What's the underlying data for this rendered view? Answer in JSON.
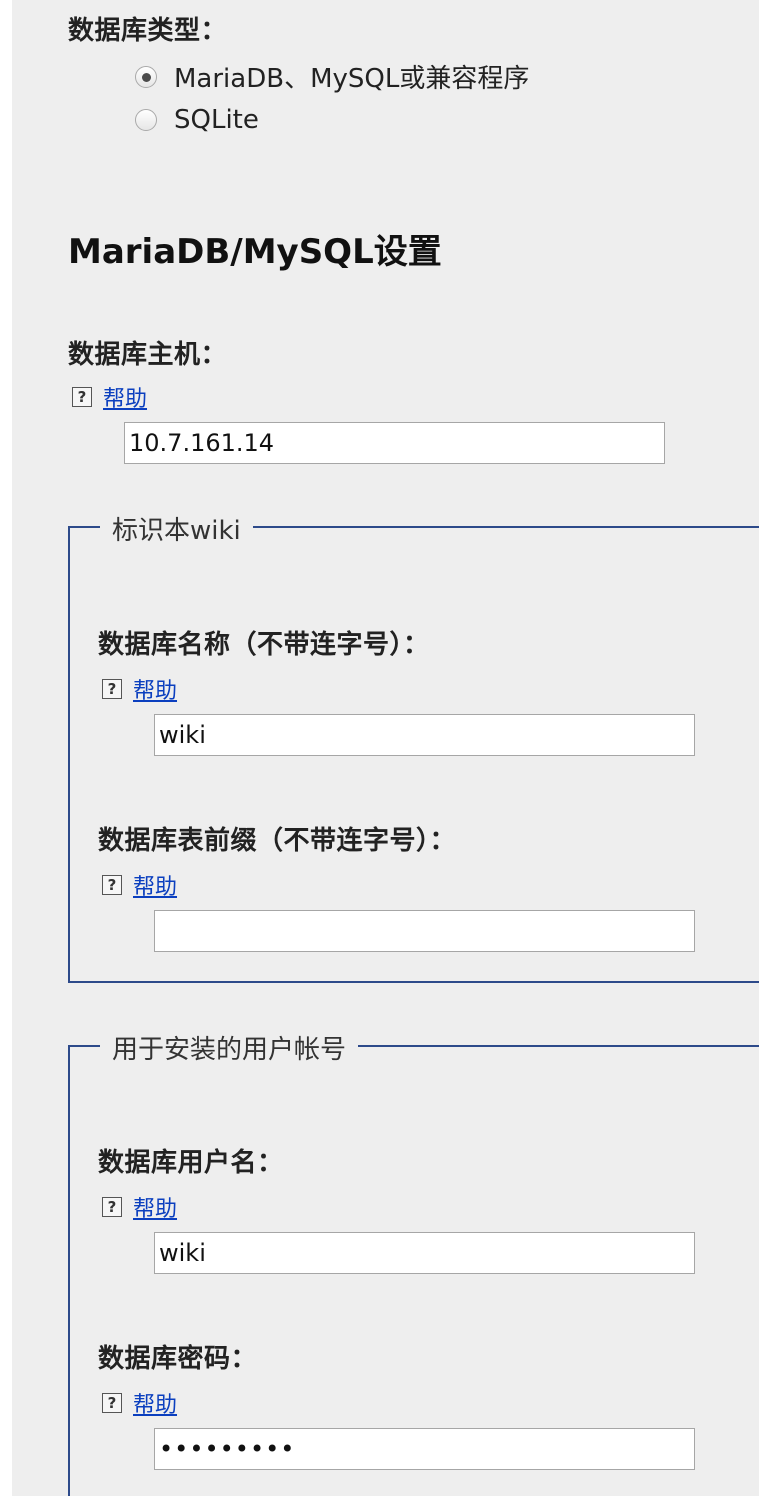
{
  "db_type": {
    "label": "数据库类型：",
    "options": [
      {
        "label": "MariaDB、MySQL或兼容程序",
        "checked": true
      },
      {
        "label": "SQLite",
        "checked": false
      }
    ]
  },
  "mysql_settings": {
    "title": "MariaDB/MySQL设置",
    "host": {
      "label": "数据库主机：",
      "help": "帮助",
      "value": "10.7.161.14"
    }
  },
  "identify_wiki": {
    "legend": "标识本wiki",
    "db_name": {
      "label": "数据库名称（不带连字号）：",
      "help": "帮助",
      "value": "wiki"
    },
    "table_prefix": {
      "label": "数据库表前缀（不带连字号）：",
      "help": "帮助",
      "value": ""
    }
  },
  "install_account": {
    "legend": "用于安装的用户帐号",
    "username": {
      "label": "数据库用户名：",
      "help": "帮助",
      "value": "wiki"
    },
    "password": {
      "label": "数据库密码：",
      "help": "帮助",
      "value": "•••••••••"
    }
  },
  "icons": {
    "help_icon_glyph": "?"
  },
  "colors": {
    "background": "#eeeeee",
    "link": "#0b3fbf",
    "fieldset_border": "#2d4a8a"
  }
}
